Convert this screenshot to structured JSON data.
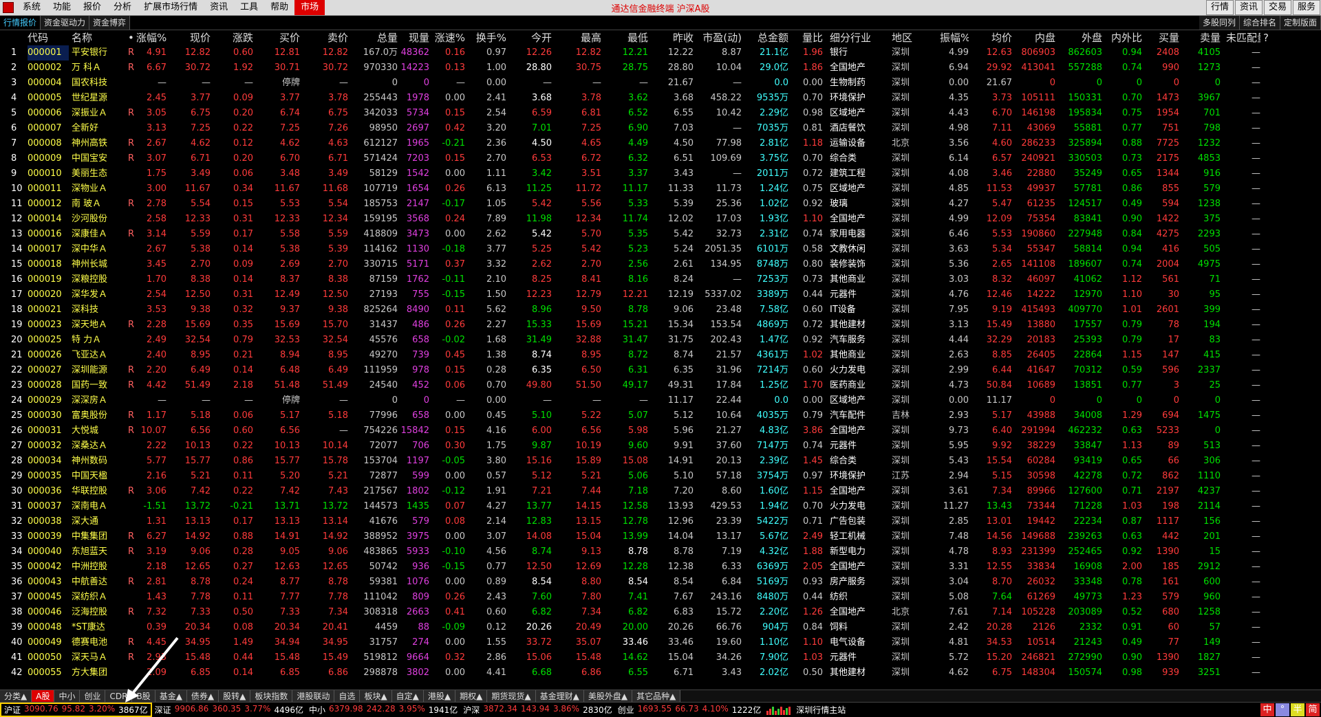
{
  "menu": {
    "items": [
      "系统",
      "功能",
      "报价",
      "分析",
      "扩展市场行情",
      "资讯",
      "工具",
      "帮助"
    ],
    "market": "市场",
    "title": "通达信金融终端 沪深A股",
    "right": [
      "行情",
      "资讯",
      "交易",
      "服务"
    ]
  },
  "tabs": {
    "left": [
      "行情报价",
      "资金驱动力",
      "资金博弈"
    ],
    "right": [
      "多股同列",
      "综合排名",
      "定制版面"
    ]
  },
  "headers": [
    "",
    "代码",
    "名称",
    "•",
    "涨幅%",
    "现价",
    "涨跌",
    "买价",
    "卖价",
    "总量",
    "现量",
    "涨速%",
    "换手%",
    "今开",
    "最高",
    "最低",
    "昨收",
    "市盈(动)",
    "总金额",
    "量比",
    "细分行业",
    "地区",
    "振幅%",
    "均价",
    "内盘",
    "外盘",
    "内外比",
    "买量",
    "卖量",
    "未匹配量"
  ],
  "header_extra": "?",
  "rows": [
    [
      "1",
      "000001",
      "平安银行",
      "R",
      "4.91",
      "12.82",
      "0.60",
      "12.81",
      "12.82",
      "167.0万",
      "48362",
      "0.16",
      "0.97",
      "12.26",
      "12.82",
      "12.21",
      "12.22",
      "8.87",
      "21.1亿",
      "1.96",
      "银行",
      "深圳",
      "4.99",
      "12.63",
      "806903",
      "862603",
      "0.94",
      "2408",
      "4105",
      "—"
    ],
    [
      "2",
      "000002",
      "万 科Ａ",
      "R",
      "6.67",
      "30.72",
      "1.92",
      "30.71",
      "30.72",
      "970330",
      "14223",
      "0.13",
      "1.00",
      "28.80",
      "30.75",
      "28.75",
      "28.80",
      "10.04",
      "29.0亿",
      "1.86",
      "全国地产",
      "深圳",
      "6.94",
      "29.92",
      "413041",
      "557288",
      "0.74",
      "990",
      "1273",
      "—"
    ],
    [
      "3",
      "000004",
      "国农科技",
      "",
      "—",
      "—",
      "—",
      "停牌",
      "—",
      "0",
      "0",
      "—",
      "0.00",
      "—",
      "—",
      "—",
      "21.67",
      "—",
      "0.0",
      "0.00",
      "生物制药",
      "深圳",
      "0.00",
      "21.67",
      "0",
      "0",
      "0",
      "0",
      "0",
      "—"
    ],
    [
      "4",
      "000005",
      "世纪星源",
      "",
      "2.45",
      "3.77",
      "0.09",
      "3.77",
      "3.78",
      "255443",
      "1978",
      "0.00",
      "2.41",
      "3.68",
      "3.78",
      "3.62",
      "3.68",
      "458.22",
      "9535万",
      "0.70",
      "环境保护",
      "深圳",
      "4.35",
      "3.73",
      "105111",
      "150331",
      "0.70",
      "1473",
      "3967",
      "—"
    ],
    [
      "5",
      "000006",
      "深振业Ａ",
      "R",
      "3.05",
      "6.75",
      "0.20",
      "6.74",
      "6.75",
      "342033",
      "5734",
      "0.15",
      "2.54",
      "6.59",
      "6.81",
      "6.52",
      "6.55",
      "10.42",
      "2.29亿",
      "0.98",
      "区域地产",
      "深圳",
      "4.43",
      "6.70",
      "146198",
      "195834",
      "0.75",
      "1954",
      "701",
      "—"
    ],
    [
      "6",
      "000007",
      "全新好",
      "",
      "3.13",
      "7.25",
      "0.22",
      "7.25",
      "7.26",
      "98950",
      "2697",
      "0.42",
      "3.20",
      "7.01",
      "7.25",
      "6.90",
      "7.03",
      "—",
      "7035万",
      "0.81",
      "酒店餐饮",
      "深圳",
      "4.98",
      "7.11",
      "43069",
      "55881",
      "0.77",
      "751",
      "798",
      "—"
    ],
    [
      "7",
      "000008",
      "神州高铁",
      "R",
      "2.67",
      "4.62",
      "0.12",
      "4.62",
      "4.63",
      "612127",
      "1965",
      "-0.21",
      "2.36",
      "4.50",
      "4.65",
      "4.49",
      "4.50",
      "77.98",
      "2.81亿",
      "1.18",
      "运输设备",
      "北京",
      "3.56",
      "4.60",
      "286233",
      "325894",
      "0.88",
      "7725",
      "1232",
      "—"
    ],
    [
      "8",
      "000009",
      "中国宝安",
      "R",
      "3.07",
      "6.71",
      "0.20",
      "6.70",
      "6.71",
      "571424",
      "7203",
      "0.15",
      "2.70",
      "6.53",
      "6.72",
      "6.32",
      "6.51",
      "109.69",
      "3.75亿",
      "0.70",
      "综合类",
      "深圳",
      "6.14",
      "6.57",
      "240921",
      "330503",
      "0.73",
      "2175",
      "4853",
      "—"
    ],
    [
      "9",
      "000010",
      "美丽生态",
      "",
      "1.75",
      "3.49",
      "0.06",
      "3.48",
      "3.49",
      "58129",
      "1542",
      "0.00",
      "1.11",
      "3.42",
      "3.51",
      "3.37",
      "3.43",
      "—",
      "2011万",
      "0.72",
      "建筑工程",
      "深圳",
      "4.08",
      "3.46",
      "22880",
      "35249",
      "0.65",
      "1344",
      "916",
      "—"
    ],
    [
      "10",
      "000011",
      "深物业Ａ",
      "",
      "3.00",
      "11.67",
      "0.34",
      "11.67",
      "11.68",
      "107719",
      "1654",
      "0.26",
      "6.13",
      "11.25",
      "11.72",
      "11.17",
      "11.33",
      "11.73",
      "1.24亿",
      "0.75",
      "区域地产",
      "深圳",
      "4.85",
      "11.53",
      "49937",
      "57781",
      "0.86",
      "855",
      "579",
      "—"
    ],
    [
      "11",
      "000012",
      "南 玻Ａ",
      "R",
      "2.78",
      "5.54",
      "0.15",
      "5.53",
      "5.54",
      "185753",
      "2147",
      "-0.17",
      "1.05",
      "5.42",
      "5.56",
      "5.33",
      "5.39",
      "25.36",
      "1.02亿",
      "0.92",
      "玻璃",
      "深圳",
      "4.27",
      "5.47",
      "61235",
      "124517",
      "0.49",
      "594",
      "1238",
      "—"
    ],
    [
      "12",
      "000014",
      "沙河股份",
      "",
      "2.58",
      "12.33",
      "0.31",
      "12.33",
      "12.34",
      "159195",
      "3568",
      "0.24",
      "7.89",
      "11.98",
      "12.34",
      "11.74",
      "12.02",
      "17.03",
      "1.93亿",
      "1.10",
      "全国地产",
      "深圳",
      "4.99",
      "12.09",
      "75354",
      "83841",
      "0.90",
      "1422",
      "375",
      "—"
    ],
    [
      "13",
      "000016",
      "深康佳Ａ",
      "R",
      "3.14",
      "5.59",
      "0.17",
      "5.58",
      "5.59",
      "418809",
      "3473",
      "0.00",
      "2.62",
      "5.42",
      "5.70",
      "5.35",
      "5.42",
      "32.73",
      "2.31亿",
      "0.74",
      "家用电器",
      "深圳",
      "6.46",
      "5.53",
      "190860",
      "227948",
      "0.84",
      "4275",
      "2293",
      "—"
    ],
    [
      "14",
      "000017",
      "深中华Ａ",
      "",
      "2.67",
      "5.38",
      "0.14",
      "5.38",
      "5.39",
      "114162",
      "1130",
      "-0.18",
      "3.77",
      "5.25",
      "5.42",
      "5.23",
      "5.24",
      "2051.35",
      "6101万",
      "0.58",
      "文教休闲",
      "深圳",
      "3.63",
      "5.34",
      "55347",
      "58814",
      "0.94",
      "416",
      "505",
      "—"
    ],
    [
      "15",
      "000018",
      "神州长城",
      "",
      "3.45",
      "2.70",
      "0.09",
      "2.69",
      "2.70",
      "330715",
      "5171",
      "0.37",
      "3.32",
      "2.62",
      "2.70",
      "2.56",
      "2.61",
      "134.95",
      "8748万",
      "0.80",
      "装修装饰",
      "深圳",
      "5.36",
      "2.65",
      "141108",
      "189607",
      "0.74",
      "2004",
      "4975",
      "—"
    ],
    [
      "16",
      "000019",
      "深粮控股",
      "",
      "1.70",
      "8.38",
      "0.14",
      "8.37",
      "8.38",
      "87159",
      "1762",
      "-0.11",
      "2.10",
      "8.25",
      "8.41",
      "8.16",
      "8.24",
      "—",
      "7253万",
      "0.73",
      "其他商业",
      "深圳",
      "3.03",
      "8.32",
      "46097",
      "41062",
      "1.12",
      "561",
      "71",
      "—"
    ],
    [
      "17",
      "000020",
      "深华发Ａ",
      "",
      "2.54",
      "12.50",
      "0.31",
      "12.49",
      "12.50",
      "27193",
      "755",
      "-0.15",
      "1.50",
      "12.23",
      "12.79",
      "12.21",
      "12.19",
      "5337.02",
      "3389万",
      "0.44",
      "元器件",
      "深圳",
      "4.76",
      "12.46",
      "14222",
      "12970",
      "1.10",
      "30",
      "95",
      "—"
    ],
    [
      "18",
      "000021",
      "深科技",
      "",
      "3.53",
      "9.38",
      "0.32",
      "9.37",
      "9.38",
      "825264",
      "8490",
      "0.11",
      "5.62",
      "8.96",
      "9.50",
      "8.78",
      "9.06",
      "23.48",
      "7.58亿",
      "0.60",
      "IT设备",
      "深圳",
      "7.95",
      "9.19",
      "415493",
      "409770",
      "1.01",
      "2601",
      "399",
      "—"
    ],
    [
      "19",
      "000023",
      "深天地Ａ",
      "R",
      "2.28",
      "15.69",
      "0.35",
      "15.69",
      "15.70",
      "31437",
      "486",
      "0.26",
      "2.27",
      "15.33",
      "15.69",
      "15.21",
      "15.34",
      "153.54",
      "4869万",
      "0.72",
      "其他建材",
      "深圳",
      "3.13",
      "15.49",
      "13880",
      "17557",
      "0.79",
      "78",
      "194",
      "—"
    ],
    [
      "20",
      "000025",
      "特 力Ａ",
      "",
      "2.49",
      "32.54",
      "0.79",
      "32.53",
      "32.54",
      "45576",
      "658",
      "-0.02",
      "1.68",
      "31.49",
      "32.88",
      "31.47",
      "31.75",
      "202.43",
      "1.47亿",
      "0.92",
      "汽车服务",
      "深圳",
      "4.44",
      "32.29",
      "20183",
      "25393",
      "0.79",
      "17",
      "83",
      "—"
    ],
    [
      "21",
      "000026",
      "飞亚达Ａ",
      "",
      "2.40",
      "8.95",
      "0.21",
      "8.94",
      "8.95",
      "49270",
      "739",
      "0.45",
      "1.38",
      "8.74",
      "8.95",
      "8.72",
      "8.74",
      "21.57",
      "4361万",
      "1.02",
      "其他商业",
      "深圳",
      "2.63",
      "8.85",
      "26405",
      "22864",
      "1.15",
      "147",
      "415",
      "—"
    ],
    [
      "22",
      "000027",
      "深圳能源",
      "R",
      "2.20",
      "6.49",
      "0.14",
      "6.48",
      "6.49",
      "111959",
      "978",
      "0.15",
      "0.28",
      "6.35",
      "6.50",
      "6.31",
      "6.35",
      "31.96",
      "7214万",
      "0.60",
      "火力发电",
      "深圳",
      "2.99",
      "6.44",
      "41647",
      "70312",
      "0.59",
      "596",
      "2337",
      "—"
    ],
    [
      "23",
      "000028",
      "国药一致",
      "R",
      "4.42",
      "51.49",
      "2.18",
      "51.48",
      "51.49",
      "24540",
      "452",
      "0.06",
      "0.70",
      "49.80",
      "51.50",
      "49.17",
      "49.31",
      "17.84",
      "1.25亿",
      "1.70",
      "医药商业",
      "深圳",
      "4.73",
      "50.84",
      "10689",
      "13851",
      "0.77",
      "3",
      "25",
      "—"
    ],
    [
      "24",
      "000029",
      "深深房Ａ",
      "",
      "—",
      "—",
      "—",
      "停牌",
      "—",
      "0",
      "0",
      "—",
      "0.00",
      "—",
      "—",
      "—",
      "11.17",
      "22.44",
      "0.0",
      "0.00",
      "区域地产",
      "深圳",
      "0.00",
      "11.17",
      "0",
      "0",
      "0",
      "0",
      "0",
      "—"
    ],
    [
      "25",
      "000030",
      "富奥股份",
      "R",
      "1.17",
      "5.18",
      "0.06",
      "5.17",
      "5.18",
      "77996",
      "658",
      "0.00",
      "0.45",
      "5.10",
      "5.22",
      "5.07",
      "5.12",
      "10.64",
      "4035万",
      "0.79",
      "汽车配件",
      "吉林",
      "2.93",
      "5.17",
      "43988",
      "34008",
      "1.29",
      "694",
      "1475",
      "—"
    ],
    [
      "26",
      "000031",
      "大悦城",
      "R",
      "10.07",
      "6.56",
      "0.60",
      "6.56",
      "—",
      "754226",
      "15842",
      "0.15",
      "4.16",
      "6.00",
      "6.56",
      "5.98",
      "5.96",
      "21.27",
      "4.83亿",
      "3.86",
      "全国地产",
      "深圳",
      "9.73",
      "6.40",
      "291994",
      "462232",
      "0.63",
      "5233",
      "0",
      "—"
    ],
    [
      "27",
      "000032",
      "深桑达Ａ",
      "",
      "2.22",
      "10.13",
      "0.22",
      "10.13",
      "10.14",
      "72077",
      "706",
      "0.30",
      "1.75",
      "9.87",
      "10.19",
      "9.60",
      "9.91",
      "37.60",
      "7147万",
      "0.74",
      "元器件",
      "深圳",
      "5.95",
      "9.92",
      "38229",
      "33847",
      "1.13",
      "89",
      "513",
      "—"
    ],
    [
      "28",
      "000034",
      "神州数码",
      "",
      "5.77",
      "15.77",
      "0.86",
      "15.77",
      "15.78",
      "153704",
      "1197",
      "-0.05",
      "3.80",
      "15.16",
      "15.89",
      "15.08",
      "14.91",
      "20.13",
      "2.39亿",
      "1.45",
      "综合类",
      "深圳",
      "5.43",
      "15.54",
      "60284",
      "93419",
      "0.65",
      "66",
      "306",
      "—"
    ],
    [
      "29",
      "000035",
      "中国天楹",
      "",
      "2.16",
      "5.21",
      "0.11",
      "5.20",
      "5.21",
      "72877",
      "599",
      "0.00",
      "0.57",
      "5.12",
      "5.21",
      "5.06",
      "5.10",
      "57.18",
      "3754万",
      "0.97",
      "环境保护",
      "江苏",
      "2.94",
      "5.15",
      "30598",
      "42278",
      "0.72",
      "862",
      "1110",
      "—"
    ],
    [
      "30",
      "000036",
      "华联控股",
      "R",
      "3.06",
      "7.42",
      "0.22",
      "7.42",
      "7.43",
      "217567",
      "1802",
      "-0.12",
      "1.91",
      "7.21",
      "7.44",
      "7.18",
      "7.20",
      "8.60",
      "1.60亿",
      "1.15",
      "全国地产",
      "深圳",
      "3.61",
      "7.34",
      "89966",
      "127600",
      "0.71",
      "2197",
      "4237",
      "—"
    ],
    [
      "31",
      "000037",
      "深南电Ａ",
      "",
      "-1.51",
      "13.72",
      "-0.21",
      "13.71",
      "13.72",
      "144573",
      "1435",
      "0.07",
      "4.27",
      "13.77",
      "14.15",
      "12.58",
      "13.93",
      "429.53",
      "1.94亿",
      "0.70",
      "火力发电",
      "深圳",
      "11.27",
      "13.43",
      "73344",
      "71228",
      "1.03",
      "198",
      "2114",
      "—"
    ],
    [
      "32",
      "000038",
      "深大通",
      "",
      "1.31",
      "13.13",
      "0.17",
      "13.13",
      "13.14",
      "41676",
      "579",
      "0.08",
      "2.14",
      "12.83",
      "13.15",
      "12.78",
      "12.96",
      "23.39",
      "5422万",
      "0.71",
      "广告包装",
      "深圳",
      "2.85",
      "13.01",
      "19442",
      "22234",
      "0.87",
      "1117",
      "156",
      "—"
    ],
    [
      "33",
      "000039",
      "中集集团",
      "R",
      "6.27",
      "14.92",
      "0.88",
      "14.91",
      "14.92",
      "388952",
      "3975",
      "0.00",
      "3.07",
      "14.08",
      "15.04",
      "13.99",
      "14.04",
      "13.17",
      "5.67亿",
      "2.49",
      "轻工机械",
      "深圳",
      "7.48",
      "14.56",
      "149688",
      "239263",
      "0.63",
      "442",
      "201",
      "—"
    ],
    [
      "34",
      "000040",
      "东旭蓝天",
      "R",
      "3.19",
      "9.06",
      "0.28",
      "9.05",
      "9.06",
      "483865",
      "5933",
      "-0.10",
      "4.56",
      "8.74",
      "9.13",
      "8.78",
      "8.78",
      "7.19",
      "4.32亿",
      "1.88",
      "新型电力",
      "深圳",
      "4.78",
      "8.93",
      "231399",
      "252465",
      "0.92",
      "1390",
      "15",
      "—"
    ],
    [
      "35",
      "000042",
      "中洲控股",
      "",
      "2.18",
      "12.65",
      "0.27",
      "12.63",
      "12.65",
      "50742",
      "936",
      "-0.15",
      "0.77",
      "12.50",
      "12.69",
      "12.28",
      "12.38",
      "6.33",
      "6369万",
      "2.05",
      "全国地产",
      "深圳",
      "3.31",
      "12.55",
      "33834",
      "16908",
      "2.00",
      "185",
      "2912",
      "—"
    ],
    [
      "36",
      "000043",
      "中航善达",
      "R",
      "2.81",
      "8.78",
      "0.24",
      "8.77",
      "8.78",
      "59381",
      "1076",
      "0.00",
      "0.89",
      "8.54",
      "8.80",
      "8.54",
      "8.54",
      "6.84",
      "5169万",
      "0.93",
      "房产服务",
      "深圳",
      "3.04",
      "8.70",
      "26032",
      "33348",
      "0.78",
      "161",
      "600",
      "—"
    ],
    [
      "37",
      "000045",
      "深纺织Ａ",
      "",
      "1.43",
      "7.78",
      "0.11",
      "7.77",
      "7.78",
      "111042",
      "809",
      "0.26",
      "2.43",
      "7.60",
      "7.80",
      "7.41",
      "7.67",
      "243.16",
      "8480万",
      "0.44",
      "纺织",
      "深圳",
      "5.08",
      "7.64",
      "61269",
      "49773",
      "1.23",
      "579",
      "960",
      "—"
    ],
    [
      "38",
      "000046",
      "泛海控股",
      "R",
      "7.32",
      "7.33",
      "0.50",
      "7.33",
      "7.34",
      "308318",
      "2663",
      "0.41",
      "0.60",
      "6.82",
      "7.34",
      "6.82",
      "6.83",
      "15.72",
      "2.20亿",
      "1.26",
      "全国地产",
      "北京",
      "7.61",
      "7.14",
      "105228",
      "203089",
      "0.52",
      "680",
      "1258",
      "—"
    ],
    [
      "39",
      "000048",
      "*ST康达",
      "",
      "0.39",
      "20.34",
      "0.08",
      "20.34",
      "20.41",
      "4459",
      "88",
      "-0.09",
      "0.12",
      "20.26",
      "20.49",
      "20.00",
      "20.26",
      "66.76",
      "904万",
      "0.84",
      "饲料",
      "深圳",
      "2.42",
      "20.28",
      "2126",
      "2332",
      "0.91",
      "60",
      "57",
      "—"
    ],
    [
      "40",
      "000049",
      "德赛电池",
      "R",
      "4.45",
      "34.95",
      "1.49",
      "34.94",
      "34.95",
      "31757",
      "274",
      "0.00",
      "1.55",
      "33.72",
      "35.07",
      "33.46",
      "33.46",
      "19.60",
      "1.10亿",
      "1.10",
      "电气设备",
      "深圳",
      "4.81",
      "34.53",
      "10514",
      "21243",
      "0.49",
      "77",
      "149",
      "—"
    ],
    [
      "41",
      "000050",
      "深天马Ａ",
      "R",
      "2.93",
      "15.48",
      "0.44",
      "15.48",
      "15.49",
      "519812",
      "9664",
      "0.32",
      "2.86",
      "15.06",
      "15.48",
      "14.62",
      "15.04",
      "34.26",
      "7.90亿",
      "1.03",
      "元器件",
      "深圳",
      "5.72",
      "15.20",
      "246821",
      "272990",
      "0.90",
      "1390",
      "1827",
      "—"
    ],
    [
      "42",
      "000055",
      "方大集团",
      "",
      "2.09",
      "6.85",
      "0.14",
      "6.85",
      "6.86",
      "298878",
      "3802",
      "0.00",
      "4.41",
      "6.68",
      "6.86",
      "6.55",
      "6.71",
      "3.43",
      "2.02亿",
      "0.50",
      "其他建材",
      "深圳",
      "4.62",
      "6.75",
      "148304",
      "150574",
      "0.98",
      "939",
      "3251",
      "—"
    ]
  ],
  "bottom_tabs": [
    "分类▲",
    "A股",
    "中小",
    "创业",
    "CDR",
    "B股",
    "基金▲",
    "债券▲",
    "股转▲",
    "板块指数",
    "港股联动",
    "自选",
    "板块▲",
    "自定▲",
    "港股▲",
    "期权▲",
    "期货现货▲",
    "基金理财▲",
    "美股外盘▲",
    "其它品种▲"
  ],
  "status": {
    "sh": {
      "name": "沪证",
      "value": "3090.76",
      "change": "95.82",
      "pct": "3.20%",
      "amount": "3867亿"
    },
    "sz": {
      "name": "深证",
      "value": "9906.86",
      "change": "360.35",
      "pct": "3.77%",
      "amount": "4496亿"
    },
    "zx": {
      "name": "中小",
      "value": "6379.98",
      "change": "242.28",
      "pct": "3.95%",
      "amount": "1941亿"
    },
    "hs": {
      "name": "沪深",
      "value": "3872.34",
      "change": "143.94",
      "pct": "3.86%",
      "amount": "2830亿"
    },
    "cy": {
      "name": "创业",
      "value": "1693.55",
      "change": "66.73",
      "pct": "4.10%",
      "amount": "1222亿"
    },
    "host": "深圳行情主站",
    "badges": [
      "中",
      "°",
      "半",
      "简"
    ]
  },
  "colors": {
    "up": "#ff3b3b",
    "down": "#00e000",
    "flat": "#c8c8c8",
    "code": "#ffff4a",
    "amount": "#40ffff",
    "accent": "#d00000",
    "highlight": "#ffd000"
  }
}
